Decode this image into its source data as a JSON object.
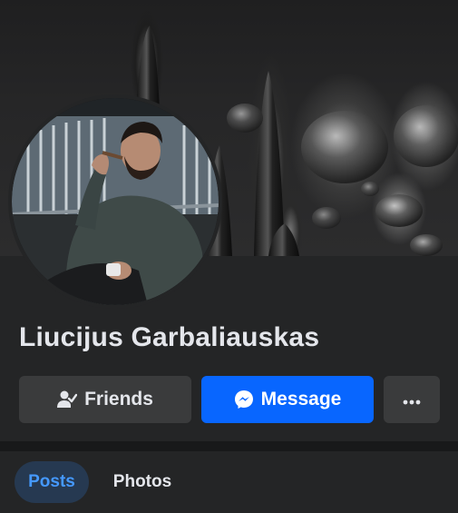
{
  "profile": {
    "name": "Liucijus Garbaliauskas"
  },
  "actions": {
    "friends_label": "Friends",
    "message_label": "Message",
    "more_icon": "more-dots-icon"
  },
  "tabs": [
    {
      "label": "Posts",
      "active": true
    },
    {
      "label": "Photos",
      "active": false
    }
  ],
  "colors": {
    "background": "#242526",
    "secondary_button": "#3a3b3c",
    "primary_button": "#0866ff",
    "active_tab_bg": "#263951",
    "active_tab_text": "#4599ff",
    "text": "#e4e6eb"
  },
  "icons": {
    "friends": "person-check-icon",
    "message": "messenger-icon"
  }
}
